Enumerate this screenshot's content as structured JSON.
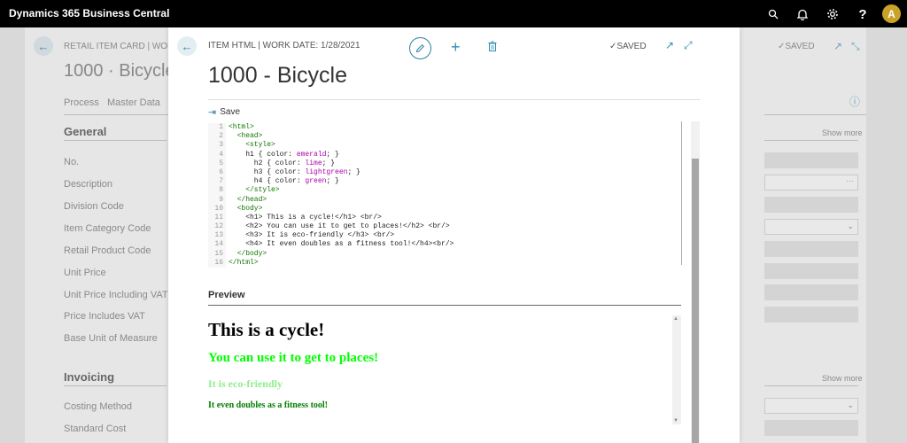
{
  "topbar": {
    "brand": "Dynamics 365 Business Central",
    "avatar_initial": "A",
    "icons": [
      "search-icon",
      "bell-icon",
      "gear-icon",
      "help-icon"
    ]
  },
  "background": {
    "breadcrumb": "RETAIL ITEM CARD | WORK D",
    "title": "1000 · Bicycle",
    "tabs": [
      "Process",
      "Master Data"
    ],
    "saved": "SAVED",
    "sections": [
      {
        "label": "General",
        "show_more": "Show more"
      },
      {
        "label": "Invoicing",
        "show_more": "Show more"
      }
    ],
    "general_fields": [
      "No.",
      "Description",
      "Division Code",
      "Item Category Code",
      "Retail Product Code",
      "Unit Price",
      "Unit Price Including VAT",
      "Price Includes VAT",
      "Base Unit of Measure"
    ],
    "invoicing_fields": [
      "Costing Method",
      "Standard Cost"
    ]
  },
  "modal": {
    "breadcrumb": "ITEM HTML | WORK DATE: 1/28/2021",
    "saved": "SAVED",
    "title": "1000 - Bicycle",
    "save_label": "Save",
    "preview_label": "Preview"
  },
  "code_lines": [
    "<html>",
    "  <head>",
    "    <style>",
    "    h1 { color: emerald; }",
    "      h2 { color: lime; }",
    "      h3 { color: lightgreen; }",
    "      h4 { color: green; }",
    "    </style>",
    "  </head>",
    "  <body>",
    "    <h1> This is a cycle!</h1> <br/>",
    "    <h2> You can use it to get to places!</h2> <br/>",
    "    <h3> It is eco-friendly </h3> <br/>",
    "    <h4> It even doubles as a fitness tool!</h4><br/>",
    "  </body>",
    "</html>"
  ],
  "preview": {
    "h1": "This is a cycle!",
    "h2": "You can use it to get to places!",
    "h3": "It is eco-friendly",
    "h4": "It even doubles as a fitness tool!"
  }
}
